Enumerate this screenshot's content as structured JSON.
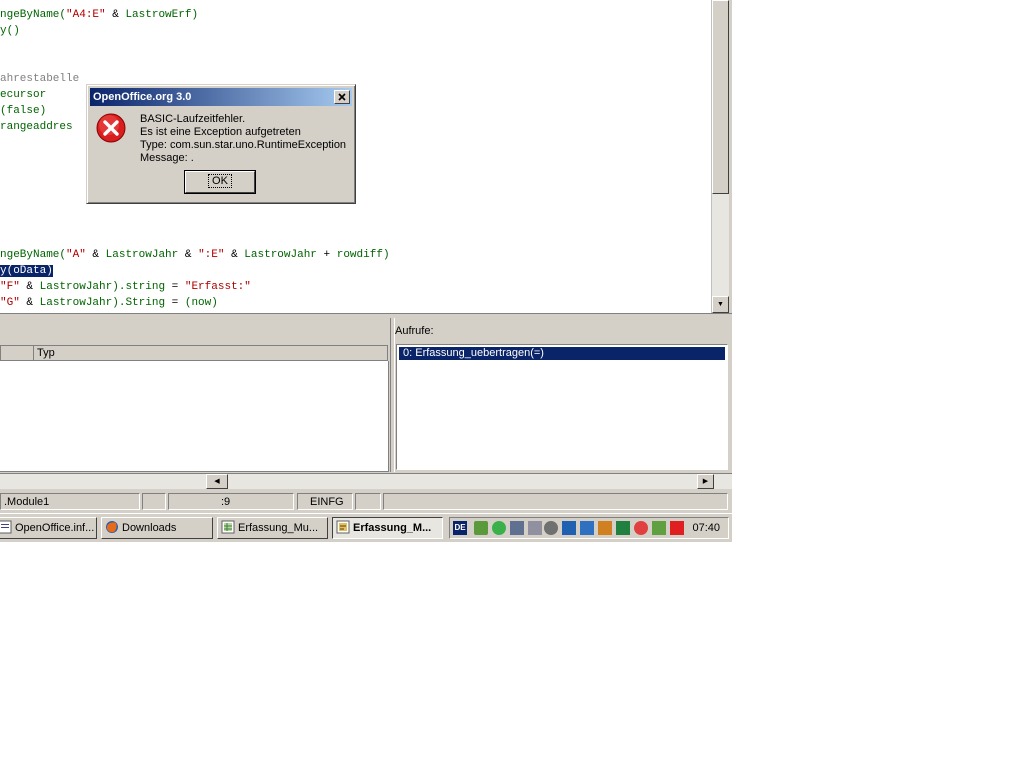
{
  "editor": {
    "lines": [
      {
        "segments": [
          {
            "t": "ngeByName(",
            "c": "id"
          },
          {
            "t": "\"A4:E\"",
            "c": "str"
          },
          {
            "t": " & ",
            "c": "op"
          },
          {
            "t": "LastrowErf)",
            "c": "id"
          }
        ]
      },
      {
        "segments": [
          {
            "t": "y()",
            "c": "id"
          }
        ]
      },
      {
        "segments": []
      },
      {
        "segments": []
      },
      {
        "segments": [
          {
            "t": "ahrestabelle",
            "c": "cmt"
          }
        ]
      },
      {
        "segments": [
          {
            "t": "ecursor",
            "c": "id"
          }
        ]
      },
      {
        "segments": [
          {
            "t": "(false)",
            "c": "id"
          }
        ]
      },
      {
        "segments": [
          {
            "t": "rangeaddres",
            "c": "id"
          }
        ]
      },
      {
        "segments": []
      },
      {
        "segments": []
      },
      {
        "segments": []
      },
      {
        "segments": []
      },
      {
        "segments": []
      },
      {
        "segments": []
      },
      {
        "segments": []
      },
      {
        "segments": [
          {
            "t": "ngeByName(",
            "c": "id"
          },
          {
            "t": "\"A\"",
            "c": "str"
          },
          {
            "t": " & ",
            "c": "op"
          },
          {
            "t": "LastrowJahr",
            "c": "id"
          },
          {
            "t": " & ",
            "c": "op"
          },
          {
            "t": "\":E\"",
            "c": "str"
          },
          {
            "t": " & ",
            "c": "op"
          },
          {
            "t": "LastrowJahr",
            "c": "id"
          },
          {
            "t": " + ",
            "c": "op"
          },
          {
            "t": "rowdiff)",
            "c": "id"
          }
        ]
      },
      {
        "segments": [
          {
            "t": "y(oData)",
            "c": "sel"
          }
        ]
      },
      {
        "segments": [
          {
            "t": "\"F\"",
            "c": "str"
          },
          {
            "t": " & ",
            "c": "op"
          },
          {
            "t": "LastrowJahr).string",
            "c": "id"
          },
          {
            "t": " = ",
            "c": "op"
          },
          {
            "t": "\"Erfasst:\"",
            "c": "str"
          }
        ]
      },
      {
        "segments": [
          {
            "t": "\"G\"",
            "c": "str"
          },
          {
            "t": " & ",
            "c": "op"
          },
          {
            "t": "LastrowJahr).String",
            "c": "id"
          },
          {
            "t": " = ",
            "c": "op"
          },
          {
            "t": "(now)",
            "c": "id"
          }
        ]
      }
    ]
  },
  "watch": {
    "column_type": "Typ"
  },
  "calls": {
    "label": "Aufrufe:",
    "items": [
      "0: Erfassung_uebertragen(=)"
    ]
  },
  "statusbar": {
    "module": ".Module1",
    "position": ":9",
    "mode": "EINFG"
  },
  "taskbar": {
    "buttons": [
      {
        "label": "OpenOffice.inf...",
        "icon": "openoffice-icon"
      },
      {
        "label": "Downloads",
        "icon": "firefox-icon"
      },
      {
        "label": "Erfassung_Mu...",
        "icon": "spreadsheet-icon"
      },
      {
        "label": "Erfassung_M...",
        "icon": "basic-ide-icon",
        "active": true
      }
    ],
    "lang": "DE",
    "clock": "07:40"
  },
  "dialog": {
    "title": "OpenOffice.org 3.0",
    "message_lines": [
      "BASIC-Laufzeitfehler.",
      "Es ist eine Exception aufgetreten",
      "Type: com.sun.star.uno.RuntimeException",
      "Message: ."
    ],
    "ok_label": "OK",
    "icon": "error-icon"
  }
}
